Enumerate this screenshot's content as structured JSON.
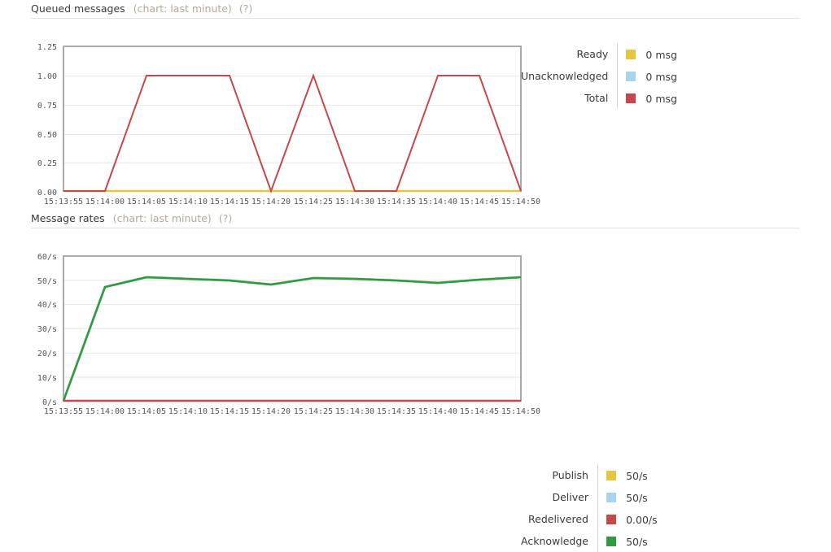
{
  "sections": [
    {
      "title": "Queued messages",
      "subtitle": "(chart: last minute)",
      "help": "(?)",
      "legend": [
        {
          "label": "Ready",
          "value": "0 msg",
          "color": "#e8c33c"
        },
        {
          "label": "Unacknowledged",
          "value": "0 msg",
          "color": "#a8d4f0"
        },
        {
          "label": "Total",
          "value": "0 msg",
          "color": "#c8474a"
        }
      ]
    },
    {
      "title": "Message rates",
      "subtitle": "(chart: last minute)",
      "help": "(?)",
      "legend": [
        {
          "label": "Publish",
          "value": "50/s",
          "color": "#e8c33c"
        },
        {
          "label": "Deliver",
          "value": "50/s",
          "color": "#a8d4f0"
        },
        {
          "label": "Redelivered",
          "value": "0.00/s",
          "color": "#c8474a"
        },
        {
          "label": "Acknowledge",
          "value": "50/s",
          "color": "#2e9b3e"
        }
      ]
    }
  ],
  "chart_data": [
    {
      "type": "line",
      "title": "Queued messages (chart: last minute)",
      "xlabel": "",
      "ylabel": "",
      "ylim": [
        0,
        1.25
      ],
      "yticks": [
        0.0,
        0.25,
        0.5,
        0.75,
        1.0,
        1.25
      ],
      "ytick_labels": [
        "0.00",
        "0.25",
        "0.50",
        "0.75",
        "1.00",
        "1.25"
      ],
      "x": [
        "15:13:55",
        "15:14:00",
        "15:14:05",
        "15:14:10",
        "15:14:15",
        "15:14:20",
        "15:14:25",
        "15:14:30",
        "15:14:35",
        "15:14:40",
        "15:14:45",
        "15:14:50"
      ],
      "grid": true,
      "legend_position": "right",
      "series": [
        {
          "name": "Total",
          "color": "#c8474a",
          "values": [
            0,
            0,
            1,
            1,
            1,
            0,
            1,
            0,
            0,
            1,
            1,
            0
          ]
        },
        {
          "name": "Ready",
          "color": "#e8c33c",
          "values": [
            0,
            0,
            0,
            0,
            0,
            0,
            0,
            0,
            0,
            0,
            0,
            0
          ]
        },
        {
          "name": "Unacknowledged",
          "color": "#a8d4f0",
          "values": [
            0,
            0,
            0,
            0,
            0,
            0,
            0,
            0,
            0,
            0,
            0,
            0
          ]
        }
      ]
    },
    {
      "type": "line",
      "title": "Message rates (chart: last minute)",
      "xlabel": "",
      "ylabel": "",
      "ylim": [
        0,
        60
      ],
      "yticks": [
        0,
        10,
        20,
        30,
        40,
        50,
        60
      ],
      "ytick_labels": [
        "0/s",
        "10/s",
        "20/s",
        "30/s",
        "40/s",
        "50/s",
        "60/s"
      ],
      "x": [
        "15:13:55",
        "15:14:00",
        "15:14:05",
        "15:14:10",
        "15:14:15",
        "15:14:20",
        "15:14:25",
        "15:14:30",
        "15:14:35",
        "15:14:40",
        "15:14:45",
        "15:14:50"
      ],
      "grid": true,
      "legend_position": "right",
      "series": [
        {
          "name": "Acknowledge",
          "color": "#2e9b3e",
          "values": [
            0,
            47,
            51,
            50.4,
            49.6,
            48,
            50.6,
            50.4,
            49.8,
            48.6,
            50,
            51
          ]
        },
        {
          "name": "Publish",
          "color": "#e8c33c",
          "values": [
            0,
            47,
            51,
            50.4,
            49.6,
            48,
            50.6,
            50.4,
            49.8,
            48.6,
            50,
            51
          ]
        },
        {
          "name": "Deliver",
          "color": "#a8d4f0",
          "values": [
            0,
            47,
            51,
            50.4,
            49.6,
            48,
            50.6,
            50.4,
            49.8,
            48.6,
            50,
            51
          ]
        },
        {
          "name": "Redelivered",
          "color": "#c8474a",
          "values": [
            0,
            0,
            0,
            0,
            0,
            0,
            0,
            0,
            0,
            0,
            0,
            0
          ]
        }
      ]
    }
  ]
}
